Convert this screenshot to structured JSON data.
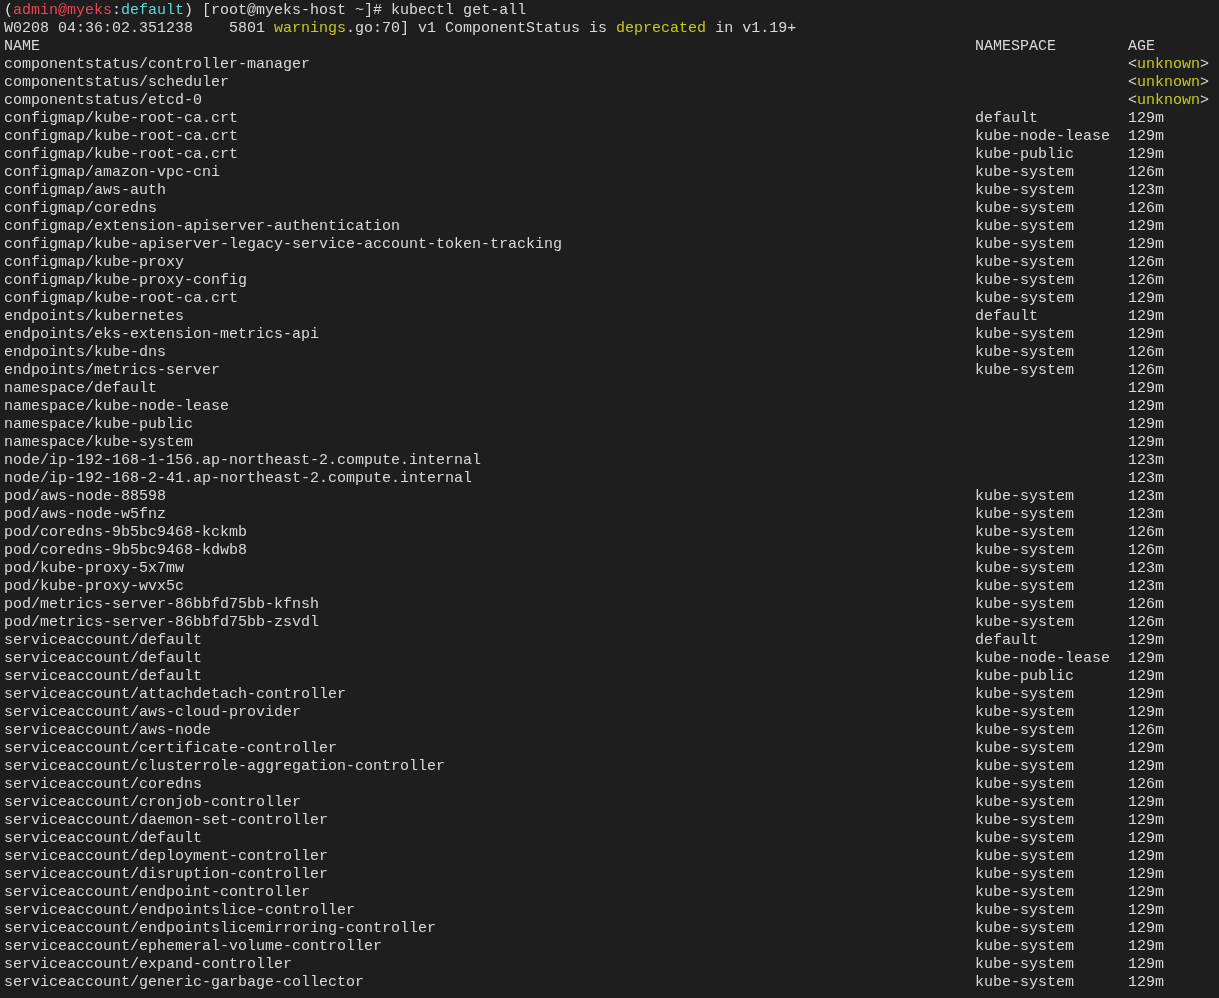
{
  "prompt": [
    {
      "text": "(",
      "kind": "plain"
    },
    {
      "text": "admin@myeks",
      "kind": "user"
    },
    {
      "text": ":",
      "kind": "plain"
    },
    {
      "text": "default",
      "kind": "context"
    },
    {
      "text": ") [root@myeks-host ~]# kubectl get-all",
      "kind": "plain"
    }
  ],
  "warning": [
    {
      "text": "W0208 04:36:02.351238    5801 ",
      "kind": "plain"
    },
    {
      "text": "warnings",
      "kind": "highlight"
    },
    {
      "text": ".go:70] v1 ComponentStatus is ",
      "kind": "plain"
    },
    {
      "text": "deprecated",
      "kind": "highlight"
    },
    {
      "text": " in v1.19+",
      "kind": "plain"
    }
  ],
  "columns": [
    "NAME",
    "NAMESPACE",
    "AGE"
  ],
  "rows": [
    {
      "name": "componentstatus/controller-manager",
      "age": [
        {
          "text": "<",
          "kind": "plain"
        },
        {
          "text": "unknown",
          "kind": "highlight"
        },
        {
          "text": ">",
          "kind": "plain"
        }
      ]
    },
    {
      "name": "componentstatus/scheduler",
      "age": [
        {
          "text": "<",
          "kind": "plain"
        },
        {
          "text": "unknown",
          "kind": "highlight"
        },
        {
          "text": ">",
          "kind": "plain"
        }
      ]
    },
    {
      "name": "componentstatus/etcd-0",
      "age": [
        {
          "text": "<",
          "kind": "plain"
        },
        {
          "text": "unknown",
          "kind": "highlight"
        },
        {
          "text": ">",
          "kind": "plain"
        }
      ]
    },
    {
      "name": "configmap/kube-root-ca.crt",
      "namespace": "default",
      "age": [
        {
          "text": "129m",
          "kind": "plain"
        }
      ]
    },
    {
      "name": "configmap/kube-root-ca.crt",
      "namespace": "kube-node-lease",
      "age": [
        {
          "text": "129m",
          "kind": "plain"
        }
      ]
    },
    {
      "name": "configmap/kube-root-ca.crt",
      "namespace": "kube-public",
      "age": [
        {
          "text": "129m",
          "kind": "plain"
        }
      ]
    },
    {
      "name": "configmap/amazon-vpc-cni",
      "namespace": "kube-system",
      "age": [
        {
          "text": "126m",
          "kind": "plain"
        }
      ]
    },
    {
      "name": "configmap/aws-auth",
      "namespace": "kube-system",
      "age": [
        {
          "text": "123m",
          "kind": "plain"
        }
      ]
    },
    {
      "name": "configmap/coredns",
      "namespace": "kube-system",
      "age": [
        {
          "text": "126m",
          "kind": "plain"
        }
      ]
    },
    {
      "name": "configmap/extension-apiserver-authentication",
      "namespace": "kube-system",
      "age": [
        {
          "text": "129m",
          "kind": "plain"
        }
      ]
    },
    {
      "name": "configmap/kube-apiserver-legacy-service-account-token-tracking",
      "namespace": "kube-system",
      "age": [
        {
          "text": "129m",
          "kind": "plain"
        }
      ]
    },
    {
      "name": "configmap/kube-proxy",
      "namespace": "kube-system",
      "age": [
        {
          "text": "126m",
          "kind": "plain"
        }
      ]
    },
    {
      "name": "configmap/kube-proxy-config",
      "namespace": "kube-system",
      "age": [
        {
          "text": "126m",
          "kind": "plain"
        }
      ]
    },
    {
      "name": "configmap/kube-root-ca.crt",
      "namespace": "kube-system",
      "age": [
        {
          "text": "129m",
          "kind": "plain"
        }
      ]
    },
    {
      "name": "endpoints/kubernetes",
      "namespace": "default",
      "age": [
        {
          "text": "129m",
          "kind": "plain"
        }
      ]
    },
    {
      "name": "endpoints/eks-extension-metrics-api",
      "namespace": "kube-system",
      "age": [
        {
          "text": "129m",
          "kind": "plain"
        }
      ]
    },
    {
      "name": "endpoints/kube-dns",
      "namespace": "kube-system",
      "age": [
        {
          "text": "126m",
          "kind": "plain"
        }
      ]
    },
    {
      "name": "endpoints/metrics-server",
      "namespace": "kube-system",
      "age": [
        {
          "text": "126m",
          "kind": "plain"
        }
      ]
    },
    {
      "name": "namespace/default",
      "age": [
        {
          "text": "129m",
          "kind": "plain"
        }
      ]
    },
    {
      "name": "namespace/kube-node-lease",
      "age": [
        {
          "text": "129m",
          "kind": "plain"
        }
      ]
    },
    {
      "name": "namespace/kube-public",
      "age": [
        {
          "text": "129m",
          "kind": "plain"
        }
      ]
    },
    {
      "name": "namespace/kube-system",
      "age": [
        {
          "text": "129m",
          "kind": "plain"
        }
      ]
    },
    {
      "name": "node/ip-192-168-1-156.ap-northeast-2.compute.internal",
      "age": [
        {
          "text": "123m",
          "kind": "plain"
        }
      ]
    },
    {
      "name": "node/ip-192-168-2-41.ap-northeast-2.compute.internal",
      "age": [
        {
          "text": "123m",
          "kind": "plain"
        }
      ]
    },
    {
      "name": "pod/aws-node-88598",
      "namespace": "kube-system",
      "age": [
        {
          "text": "123m",
          "kind": "plain"
        }
      ]
    },
    {
      "name": "pod/aws-node-w5fnz",
      "namespace": "kube-system",
      "age": [
        {
          "text": "123m",
          "kind": "plain"
        }
      ]
    },
    {
      "name": "pod/coredns-9b5bc9468-kckmb",
      "namespace": "kube-system",
      "age": [
        {
          "text": "126m",
          "kind": "plain"
        }
      ]
    },
    {
      "name": "pod/coredns-9b5bc9468-kdwb8",
      "namespace": "kube-system",
      "age": [
        {
          "text": "126m",
          "kind": "plain"
        }
      ]
    },
    {
      "name": "pod/kube-proxy-5x7mw",
      "namespace": "kube-system",
      "age": [
        {
          "text": "123m",
          "kind": "plain"
        }
      ]
    },
    {
      "name": "pod/kube-proxy-wvx5c",
      "namespace": "kube-system",
      "age": [
        {
          "text": "123m",
          "kind": "plain"
        }
      ]
    },
    {
      "name": "pod/metrics-server-86bbfd75bb-kfnsh",
      "namespace": "kube-system",
      "age": [
        {
          "text": "126m",
          "kind": "plain"
        }
      ]
    },
    {
      "name": "pod/metrics-server-86bbfd75bb-zsvdl",
      "namespace": "kube-system",
      "age": [
        {
          "text": "126m",
          "kind": "plain"
        }
      ]
    },
    {
      "name": "serviceaccount/default",
      "namespace": "default",
      "age": [
        {
          "text": "129m",
          "kind": "plain"
        }
      ]
    },
    {
      "name": "serviceaccount/default",
      "namespace": "kube-node-lease",
      "age": [
        {
          "text": "129m",
          "kind": "plain"
        }
      ]
    },
    {
      "name": "serviceaccount/default",
      "namespace": "kube-public",
      "age": [
        {
          "text": "129m",
          "kind": "plain"
        }
      ]
    },
    {
      "name": "serviceaccount/attachdetach-controller",
      "namespace": "kube-system",
      "age": [
        {
          "text": "129m",
          "kind": "plain"
        }
      ]
    },
    {
      "name": "serviceaccount/aws-cloud-provider",
      "namespace": "kube-system",
      "age": [
        {
          "text": "129m",
          "kind": "plain"
        }
      ]
    },
    {
      "name": "serviceaccount/aws-node",
      "namespace": "kube-system",
      "age": [
        {
          "text": "126m",
          "kind": "plain"
        }
      ]
    },
    {
      "name": "serviceaccount/certificate-controller",
      "namespace": "kube-system",
      "age": [
        {
          "text": "129m",
          "kind": "plain"
        }
      ]
    },
    {
      "name": "serviceaccount/clusterrole-aggregation-controller",
      "namespace": "kube-system",
      "age": [
        {
          "text": "129m",
          "kind": "plain"
        }
      ]
    },
    {
      "name": "serviceaccount/coredns",
      "namespace": "kube-system",
      "age": [
        {
          "text": "126m",
          "kind": "plain"
        }
      ]
    },
    {
      "name": "serviceaccount/cronjob-controller",
      "namespace": "kube-system",
      "age": [
        {
          "text": "129m",
          "kind": "plain"
        }
      ]
    },
    {
      "name": "serviceaccount/daemon-set-controller",
      "namespace": "kube-system",
      "age": [
        {
          "text": "129m",
          "kind": "plain"
        }
      ]
    },
    {
      "name": "serviceaccount/default",
      "namespace": "kube-system",
      "age": [
        {
          "text": "129m",
          "kind": "plain"
        }
      ]
    },
    {
      "name": "serviceaccount/deployment-controller",
      "namespace": "kube-system",
      "age": [
        {
          "text": "129m",
          "kind": "plain"
        }
      ]
    },
    {
      "name": "serviceaccount/disruption-controller",
      "namespace": "kube-system",
      "age": [
        {
          "text": "129m",
          "kind": "plain"
        }
      ]
    },
    {
      "name": "serviceaccount/endpoint-controller",
      "namespace": "kube-system",
      "age": [
        {
          "text": "129m",
          "kind": "plain"
        }
      ]
    },
    {
      "name": "serviceaccount/endpointslice-controller",
      "namespace": "kube-system",
      "age": [
        {
          "text": "129m",
          "kind": "plain"
        }
      ]
    },
    {
      "name": "serviceaccount/endpointslicemirroring-controller",
      "namespace": "kube-system",
      "age": [
        {
          "text": "129m",
          "kind": "plain"
        }
      ]
    },
    {
      "name": "serviceaccount/ephemeral-volume-controller",
      "namespace": "kube-system",
      "age": [
        {
          "text": "129m",
          "kind": "plain"
        }
      ]
    },
    {
      "name": "serviceaccount/expand-controller",
      "namespace": "kube-system",
      "age": [
        {
          "text": "129m",
          "kind": "plain"
        }
      ]
    },
    {
      "name": "serviceaccount/generic-garbage-collector",
      "namespace": "kube-system",
      "age": [
        {
          "text": "129m",
          "kind": "plain"
        }
      ]
    }
  ]
}
